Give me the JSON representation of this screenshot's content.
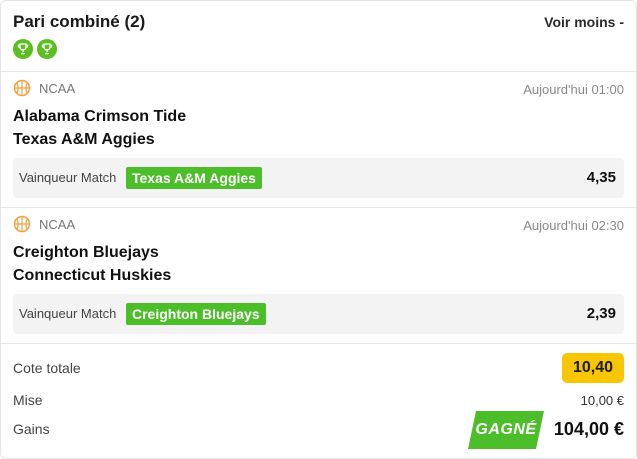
{
  "header": {
    "title": "Pari combiné (2)",
    "toggle_label": "Voir moins -"
  },
  "events": [
    {
      "league": "NCAA",
      "time": "Aujourd'hui 01:00",
      "home": "Alabama Crimson Tide",
      "away": "Texas A&M Aggies",
      "market": "Vainqueur Match",
      "pick": "Texas A&M Aggies",
      "odds": "4,35",
      "result": "won"
    },
    {
      "league": "NCAA",
      "time": "Aujourd'hui 02:30",
      "home": "Creighton Bluejays",
      "away": "Connecticut Huskies",
      "market": "Vainqueur Match",
      "pick": "Creighton Bluejays",
      "odds": "2,39",
      "result": "won"
    }
  ],
  "summary": {
    "total_odds_label": "Cote totale",
    "total_odds": "10,40",
    "stake_label": "Mise",
    "stake": "10,00 €",
    "gains_label": "Gains",
    "status": "GAGNÉ",
    "gains": "104,00 €"
  },
  "colors": {
    "win_green": "#4cbe2a",
    "trophy_green": "#5bbf1f",
    "total_yellow": "#f7c600",
    "basketball_orange": "#f0a040"
  },
  "icons": {
    "trophy": "trophy-icon",
    "sport": "basketball-icon"
  }
}
